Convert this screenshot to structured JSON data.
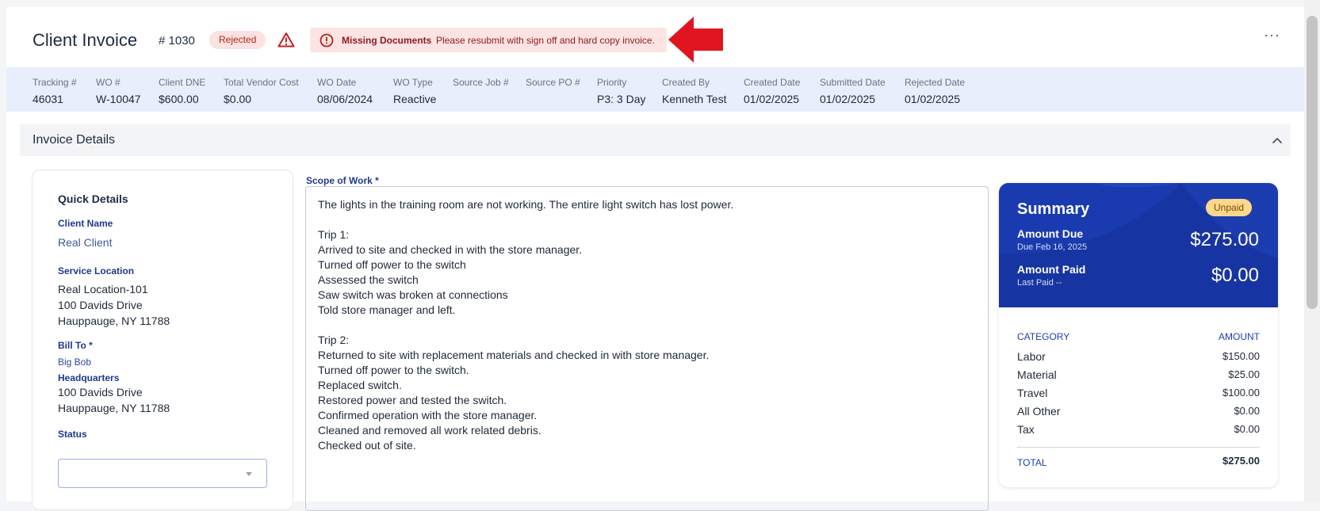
{
  "header": {
    "title": "Client Invoice",
    "number": "# 1030",
    "status_badge": "Rejected",
    "alert_title": "Missing Documents",
    "alert_message": "Please resubmit with sign off and hard copy invoice.",
    "more_label": "···"
  },
  "info": [
    {
      "label": "Tracking #",
      "value": "46031"
    },
    {
      "label": "WO #",
      "value": "W-10047"
    },
    {
      "label": "Client DNE",
      "value": "$600.00"
    },
    {
      "label": "Total Vendor Cost",
      "value": "$0.00"
    },
    {
      "label": "WO Date",
      "value": "08/06/2024"
    },
    {
      "label": "WO Type",
      "value": "Reactive"
    },
    {
      "label": "Source Job #",
      "value": ""
    },
    {
      "label": "Source PO #",
      "value": ""
    },
    {
      "label": "Priority",
      "value": "P3: 3 Day"
    },
    {
      "label": "Created By",
      "value": "Kenneth Test"
    },
    {
      "label": "Created Date",
      "value": "01/02/2025"
    },
    {
      "label": "Submitted Date",
      "value": "01/02/2025"
    },
    {
      "label": "Rejected Date",
      "value": "01/02/2025"
    }
  ],
  "details": {
    "section_title": "Invoice Details"
  },
  "quick": {
    "title": "Quick Details",
    "client_name_label": "Client Name",
    "client_name": "Real Client",
    "service_location_label": "Service Location",
    "service_location": [
      "Real Location-101",
      "100 Davids Drive",
      "Hauppauge, NY 11788"
    ],
    "bill_to_label": "Bill To *",
    "bill_to_name": "Big Bob",
    "bill_to_org": "Headquarters",
    "bill_to_address": [
      "100 Davids Drive",
      "Hauppauge, NY 11788"
    ],
    "status_label": "Status",
    "status_value": ""
  },
  "scope": {
    "label": "Scope of Work *",
    "lines": [
      "The lights in the training room are not working. The entire light switch has lost power.",
      "",
      "Trip 1:",
      "Arrived to site and checked in with the store manager.",
      "Turned off power to the switch",
      "Assessed the switch",
      "Saw switch was broken at connections",
      "Told store manager and left.",
      "",
      "Trip 2:",
      "Returned to site with replacement materials and checked in with store manager.",
      "Turned off power to the switch.",
      "Replaced switch.",
      "Restored power and tested the switch.",
      "Confirmed operation with the store manager.",
      "Cleaned and removed all work related debris.",
      "Checked out of site."
    ]
  },
  "summary": {
    "title": "Summary",
    "badge": "Unpaid",
    "amount_due_label": "Amount Due",
    "due_date": "Due Feb 16, 2025",
    "amount_due": "$275.00",
    "amount_paid_label": "Amount Paid",
    "last_paid": "Last Paid --",
    "amount_paid": "$0.00",
    "category_header": "CATEGORY",
    "amount_header": "AMOUNT",
    "rows": [
      {
        "category": "Labor",
        "amount": "$150.00"
      },
      {
        "category": "Material",
        "amount": "$25.00"
      },
      {
        "category": "Travel",
        "amount": "$100.00"
      },
      {
        "category": "All Other",
        "amount": "$0.00"
      },
      {
        "category": "Tax",
        "amount": "$0.00"
      }
    ],
    "total_label": "TOTAL",
    "total_amount": "$275.00"
  },
  "colors": {
    "summary_blue": "#1a3bb0",
    "band_bg": "#e8eefb",
    "rejected_red": "#b42318",
    "arrow_red": "#e0141e"
  }
}
